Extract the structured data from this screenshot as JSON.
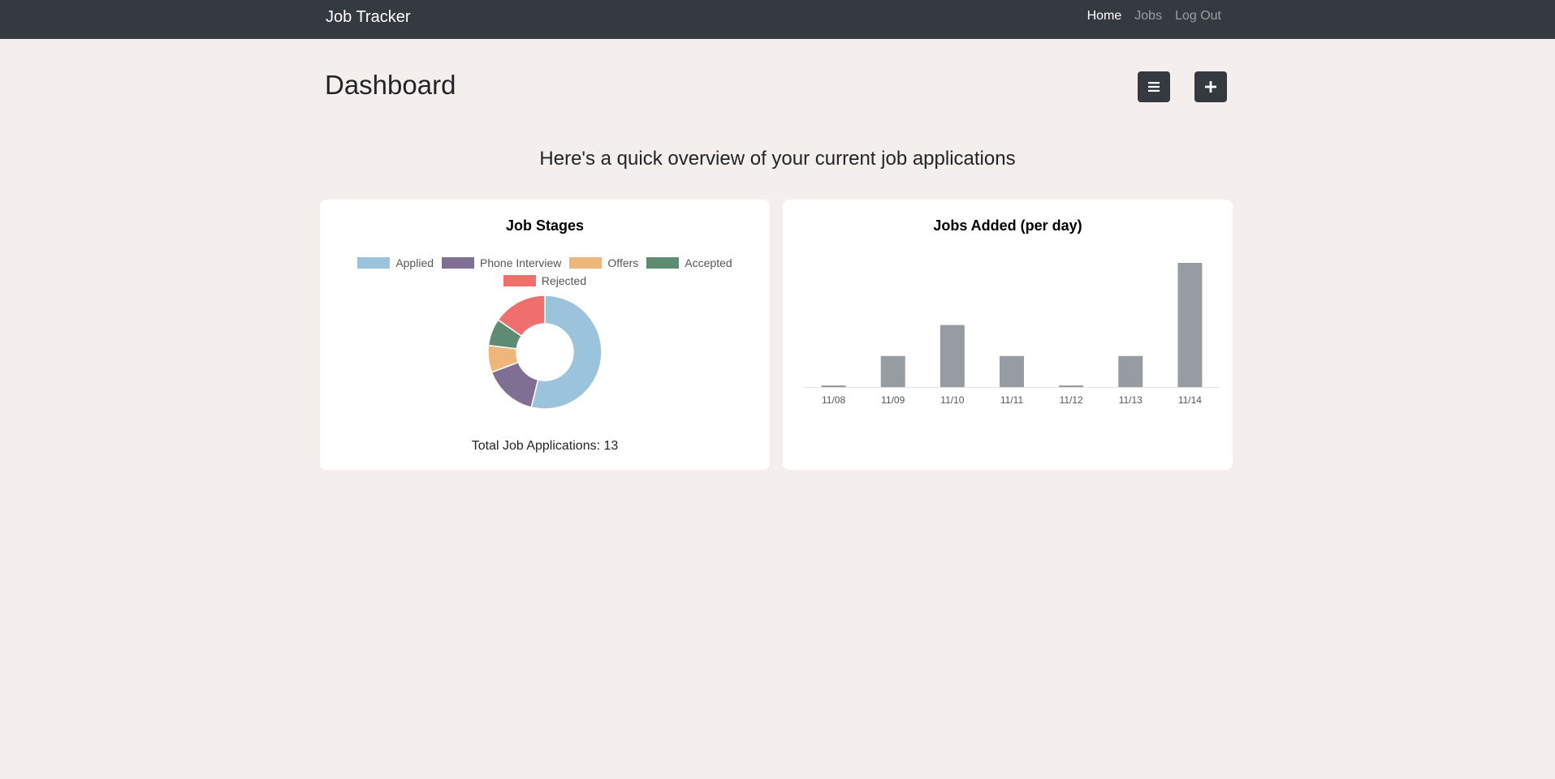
{
  "nav": {
    "brand": "Job Tracker",
    "links": [
      {
        "label": "Home",
        "active": true
      },
      {
        "label": "Jobs",
        "active": false
      },
      {
        "label": "Log Out",
        "active": false
      }
    ]
  },
  "page": {
    "title": "Dashboard",
    "subtitle": "Here's a quick overview of your current job applications",
    "list_button_icon": "list-icon",
    "add_button_icon": "plus-icon"
  },
  "stages_card": {
    "title": "Job Stages",
    "total_label": "Total Job Applications: 13"
  },
  "jobs_card": {
    "title": "Jobs Added (per day)"
  },
  "chart_data": [
    {
      "type": "pie",
      "title": "Job Stages",
      "donut": true,
      "legend_position": "top",
      "categories": [
        "Applied",
        "Phone Interview",
        "Offers",
        "Accepted",
        "Rejected"
      ],
      "values": [
        7,
        2,
        1,
        1,
        2
      ],
      "colors": [
        "#9bc4dc",
        "#7e6f93",
        "#efb67c",
        "#5e8c72",
        "#ef6f6c"
      ]
    },
    {
      "type": "bar",
      "title": "Jobs Added (per day)",
      "categories": [
        "11/08",
        "11/09",
        "11/10",
        "11/11",
        "11/12",
        "11/13",
        "11/14"
      ],
      "values": [
        0,
        1,
        2,
        1,
        0,
        1,
        4
      ],
      "ylim": [
        0,
        4
      ],
      "grid": false,
      "bar_color": "#969ca2"
    }
  ]
}
